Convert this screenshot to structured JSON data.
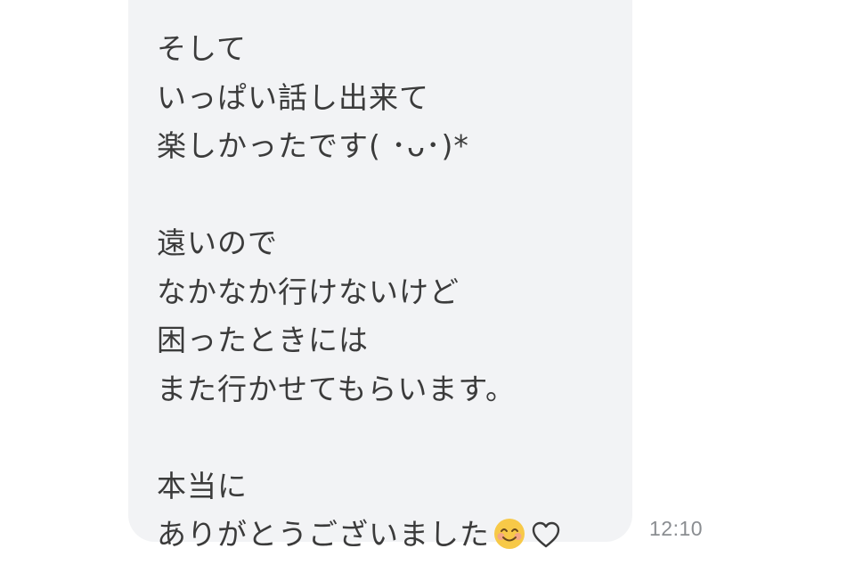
{
  "message": {
    "lines_group1": [
      "そして",
      "いっぱい話し出来て",
      "楽しかったです( ･ᴗ･)*"
    ],
    "lines_group2": [
      "遠いので",
      "なかなか行けないけど",
      "困ったときには",
      "また行かせてもらいます。"
    ],
    "line_group3": "本当に",
    "last_line": "ありがとうございました",
    "trailing_icons": [
      "smiling-face-emoji",
      "heart-outline"
    ],
    "timestamp": "12:10"
  },
  "colors": {
    "bubble": "#f2f3f5",
    "text": "#3b3b3b",
    "timestamp": "#8a8d91",
    "emoji": "#f7c948"
  }
}
